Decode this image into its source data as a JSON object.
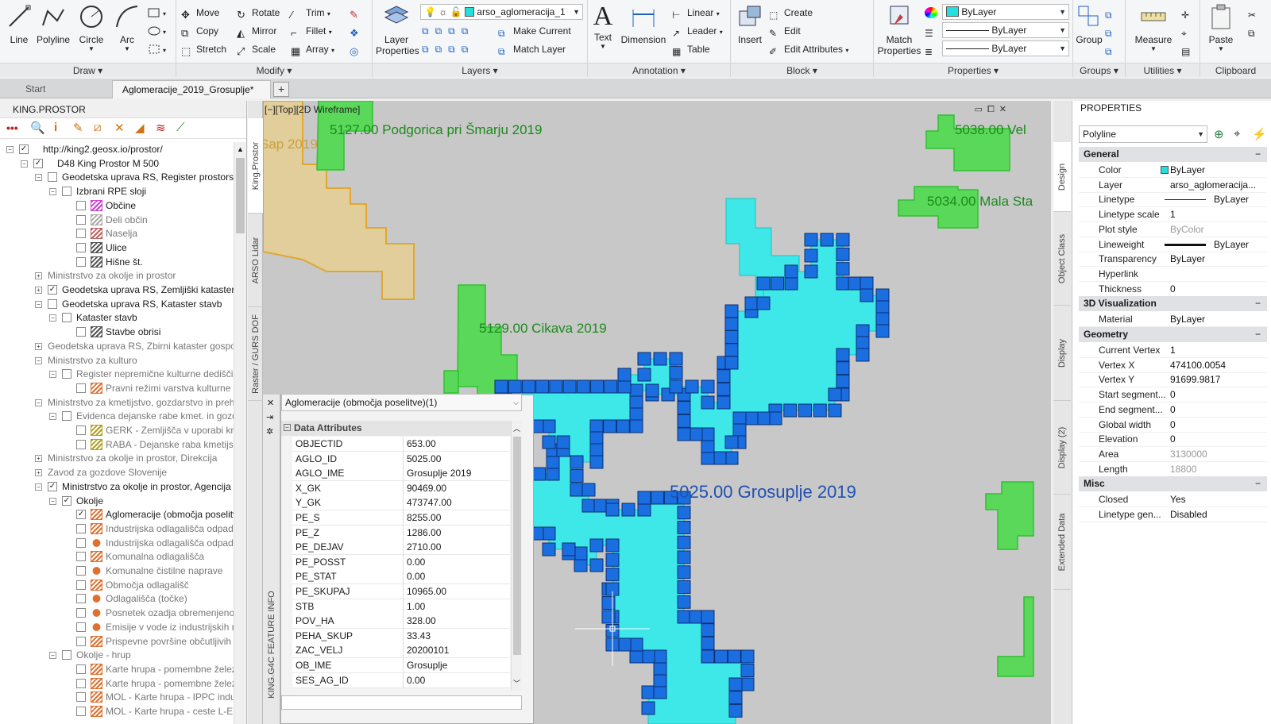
{
  "ribbon": {
    "draw": {
      "title": "Draw",
      "line": "Line",
      "polyline": "Polyline",
      "circle": "Circle",
      "arc": "Arc"
    },
    "modify": {
      "title": "Modify",
      "move": "Move",
      "rotate": "Rotate",
      "trim": "Trim",
      "copy": "Copy",
      "mirror": "Mirror",
      "fillet": "Fillet",
      "stretch": "Stretch",
      "scale": "Scale",
      "array": "Array"
    },
    "layers": {
      "title": "Layers",
      "layer_properties": "Layer Properties",
      "current_layer": "arso_aglomeracija_1",
      "make_current": "Make Current",
      "match_layer": "Match Layer"
    },
    "annotation": {
      "title": "Annotation",
      "text": "Text",
      "dimension": "Dimension",
      "linear": "Linear",
      "leader": "Leader",
      "table": "Table"
    },
    "block": {
      "title": "Block",
      "insert": "Insert",
      "create": "Create",
      "edit": "Edit",
      "edit_attributes": "Edit Attributes"
    },
    "properties": {
      "title": "Properties",
      "match_properties": "Match Properties",
      "color": "ByLayer",
      "linetype": "ByLayer",
      "lineweight": "ByLayer"
    },
    "groups": {
      "title": "Groups",
      "group": "Group"
    },
    "utilities": {
      "title": "Utilities",
      "measure": "Measure"
    },
    "clipboard": {
      "title": "Clipboard",
      "paste": "Paste"
    }
  },
  "tabs": [
    {
      "label": "Start"
    },
    {
      "label": "Aglomeracije_2019_Grosuplje*"
    }
  ],
  "left_panel": {
    "title": "KING.PROSTOR",
    "tree": [
      {
        "label": "http://king2.geosx.io/prostor/",
        "level": 0,
        "exp": "−",
        "chk": "✓"
      },
      {
        "label": "D48 King Prostor M 500",
        "level": 1,
        "exp": "−",
        "chk": "✓"
      },
      {
        "label": "Geodetska uprava RS, Register prostorskih enot",
        "level": 2,
        "exp": "−",
        "chk": "",
        "bold": true
      },
      {
        "label": "Izbrani RPE sloji",
        "level": 3,
        "exp": "−",
        "chk": ""
      },
      {
        "label": "Občine",
        "level": 4,
        "chk": "",
        "icon": "#d040d0"
      },
      {
        "label": "Deli občin",
        "level": 4,
        "chk": "",
        "icon": "#aaaaaa",
        "grey": true
      },
      {
        "label": "Naselja",
        "level": 4,
        "chk": "",
        "icon": "#c06060",
        "grey": true
      },
      {
        "label": "Ulice",
        "level": 4,
        "chk": "",
        "icon": "#555555"
      },
      {
        "label": "Hišne št.",
        "level": 4,
        "chk": "",
        "icon": "#555555"
      },
      {
        "label": "Ministrstvo za okolje in prostor",
        "level": 2,
        "exp": "+",
        "grey": true
      },
      {
        "label": "Geodetska uprava RS, Zemljiški kataster",
        "level": 2,
        "exp": "+",
        "chk": "✓",
        "bold": true
      },
      {
        "label": "Geodetska uprava RS, Kataster stavb",
        "level": 2,
        "exp": "−",
        "chk": "",
        "bold": true
      },
      {
        "label": "Kataster stavb",
        "level": 3,
        "exp": "−",
        "chk": ""
      },
      {
        "label": "Stavbe obrisi",
        "level": 4,
        "chk": "",
        "icon": "#555555"
      },
      {
        "label": "Geodetska uprava RS, Zbirni kataster gospodarske javne infrastrukture",
        "level": 2,
        "exp": "+",
        "grey": true
      },
      {
        "label": "Ministrstvo za kulturo",
        "level": 2,
        "exp": "−",
        "grey": true
      },
      {
        "label": "Register nepremične kulturne dediščine",
        "level": 3,
        "exp": "−",
        "chk": "",
        "grey": true
      },
      {
        "label": "Pravni režimi varstva kulturne dediščine",
        "level": 4,
        "chk": "",
        "icon": "#e07030",
        "grey": true
      },
      {
        "label": "Ministrstvo za kmetijstvo, gozdarstvo in prehrano",
        "level": 2,
        "exp": "−",
        "grey": true
      },
      {
        "label": "Evidenca dejanske rabe kmet. in gozd. zemljišč",
        "level": 3,
        "exp": "−",
        "chk": "",
        "grey": true
      },
      {
        "label": "GERK - Zemljišča v uporabi kmetijskih gospodarstev",
        "level": 4,
        "chk": "",
        "icon": "#b0a020",
        "grey": true
      },
      {
        "label": "RABA - Dejanske raba kmetijskih zemljišč",
        "level": 4,
        "chk": "",
        "icon": "#b0a020",
        "grey": true
      },
      {
        "label": "Ministrstvo za okolje in prostor, Direkcija",
        "level": 2,
        "exp": "+",
        "grey": true
      },
      {
        "label": "Zavod za gozdove Slovenije",
        "level": 2,
        "exp": "+",
        "grey": true
      },
      {
        "label": "Ministrstvo za okolje in prostor, Agencija RS za okolje",
        "level": 2,
        "exp": "−",
        "chk": "✓",
        "bold": true
      },
      {
        "label": "Okolje",
        "level": 3,
        "exp": "−",
        "chk": "✓"
      },
      {
        "label": "Aglomeracije (območja poselitve)",
        "level": 4,
        "chk": "✓",
        "icon": "#e07030"
      },
      {
        "label": "Industrijska odlagališča odpadkov",
        "level": 4,
        "chk": "",
        "icon": "#e07030",
        "grey": true
      },
      {
        "label": "Industrijska odlagališča odpadkov (točke)",
        "level": 4,
        "chk": "",
        "icon": "#e07030",
        "grey": true,
        "dot": true
      },
      {
        "label": "Komunalna odlagališča",
        "level": 4,
        "chk": "",
        "icon": "#e07030",
        "grey": true
      },
      {
        "label": "Komunalne čistilne naprave",
        "level": 4,
        "chk": "",
        "icon": "#e07030",
        "grey": true,
        "dot": true
      },
      {
        "label": "Območja odlagališč",
        "level": 4,
        "chk": "",
        "icon": "#e07030",
        "grey": true
      },
      {
        "label": "Odlagališča (točke)",
        "level": 4,
        "chk": "",
        "icon": "#e07030",
        "grey": true,
        "dot": true
      },
      {
        "label": "Posnetek ozadja obremenjenosti",
        "level": 4,
        "chk": "",
        "icon": "#e07030",
        "grey": true,
        "dot": true
      },
      {
        "label": "Emisije v vode iz industrijskih naprav",
        "level": 4,
        "chk": "",
        "icon": "#e07030",
        "grey": true,
        "dot": true
      },
      {
        "label": "Prispevne površine občutljivih območij",
        "level": 4,
        "chk": "",
        "icon": "#e07030",
        "grey": true
      },
      {
        "label": "Okolje - hrup",
        "level": 3,
        "exp": "−",
        "chk": "",
        "grey": true
      },
      {
        "label": "Karte hrupa - pomembne železnice",
        "level": 4,
        "chk": "",
        "icon": "#e07030",
        "grey": true
      },
      {
        "label": "Karte hrupa - pomembne železnice L",
        "level": 4,
        "chk": "",
        "icon": "#e07030",
        "grey": true
      },
      {
        "label": "MOL - Karte hrupa - IPPC industrija",
        "level": 4,
        "chk": "",
        "icon": "#e07030",
        "grey": true
      },
      {
        "label": "MOL - Karte hrupa - ceste L-E",
        "level": 4,
        "chk": "",
        "icon": "#e07030",
        "grey": true
      }
    ]
  },
  "vtabs_left": [
    "King.Prostor",
    "ARSO Lidar",
    "Raster / GURS DOF"
  ],
  "viewport": {
    "label": "[−][Top][2D Wireframe]",
    "labels": [
      {
        "text": "Sap 2019",
        "color": "#c8a040"
      },
      {
        "text": "5127.00 Podgorica pri Šmarju 2019",
        "color": "#1a8a1a"
      },
      {
        "text": "5038.00 Vel",
        "color": "#1a8a1a"
      },
      {
        "text": "5034.00 Mala Sta",
        "color": "#1a8a1a"
      },
      {
        "text": "5129.00 Cikava 2019",
        "color": "#1a8a1a"
      },
      {
        "text": "5025.00 Grosuplje 2019",
        "color": "#2050b0"
      }
    ]
  },
  "feature_info": {
    "side_label": "KING.G4C FEATURE INFO",
    "layer": "Aglomeracije (območja poselitve)(1)",
    "section": "Data Attributes",
    "rows": [
      {
        "k": "OBJECTID",
        "v": "653.00"
      },
      {
        "k": "AGLO_ID",
        "v": "5025.00"
      },
      {
        "k": "AGLO_IME",
        "v": "Grosuplje 2019"
      },
      {
        "k": "X_GK",
        "v": "90469.00"
      },
      {
        "k": "Y_GK",
        "v": "473747.00"
      },
      {
        "k": "PE_S",
        "v": "8255.00"
      },
      {
        "k": "PE_Z",
        "v": "1286.00"
      },
      {
        "k": "PE_DEJAV",
        "v": "2710.00"
      },
      {
        "k": "PE_POSST",
        "v": "0.00"
      },
      {
        "k": "PE_STAT",
        "v": "0.00"
      },
      {
        "k": "PE_SKUPAJ",
        "v": "10965.00"
      },
      {
        "k": "STB",
        "v": "1.00"
      },
      {
        "k": "POV_HA",
        "v": "328.00"
      },
      {
        "k": "PEHA_SKUP",
        "v": "33.43"
      },
      {
        "k": "ZAC_VELJ",
        "v": "20200101"
      },
      {
        "k": "OB_IME",
        "v": "Grosuplje"
      },
      {
        "k": "SES_AG_ID",
        "v": "0.00"
      }
    ]
  },
  "right_panel": {
    "title": "PROPERTIES",
    "selector": "Polyline",
    "vtabs": [
      "Design",
      "Object Class",
      "Display",
      "Display (2)",
      "Extended Data"
    ],
    "sections": [
      {
        "name": "General",
        "rows": [
          {
            "k": "Color",
            "v": "ByLayer"
          },
          {
            "k": "Layer",
            "v": "arso_aglomeracija..."
          },
          {
            "k": "Linetype",
            "v": "ByLayer"
          },
          {
            "k": "Linetype scale",
            "v": "1"
          },
          {
            "k": "Plot style",
            "v": "ByColor",
            "grey": true
          },
          {
            "k": "Lineweight",
            "v": "ByLayer"
          },
          {
            "k": "Transparency",
            "v": "ByLayer"
          },
          {
            "k": "Hyperlink",
            "v": ""
          },
          {
            "k": "Thickness",
            "v": "0"
          }
        ]
      },
      {
        "name": "3D Visualization",
        "rows": [
          {
            "k": "Material",
            "v": "ByLayer"
          }
        ]
      },
      {
        "name": "Geometry",
        "rows": [
          {
            "k": "Current Vertex",
            "v": "1"
          },
          {
            "k": "Vertex X",
            "v": "474100.0054"
          },
          {
            "k": "Vertex Y",
            "v": "91699.9817"
          },
          {
            "k": "Start  segment...",
            "v": "0"
          },
          {
            "k": "End  segment...",
            "v": "0"
          },
          {
            "k": "Global width",
            "v": "0"
          },
          {
            "k": "Elevation",
            "v": "0"
          },
          {
            "k": "Area",
            "v": "3130000",
            "grey": true
          },
          {
            "k": "Length",
            "v": "18800",
            "grey": true
          }
        ]
      },
      {
        "name": "Misc",
        "rows": [
          {
            "k": "Closed",
            "v": "Yes"
          },
          {
            "k": "Linetype gen...",
            "v": "Disabled"
          }
        ]
      }
    ]
  }
}
